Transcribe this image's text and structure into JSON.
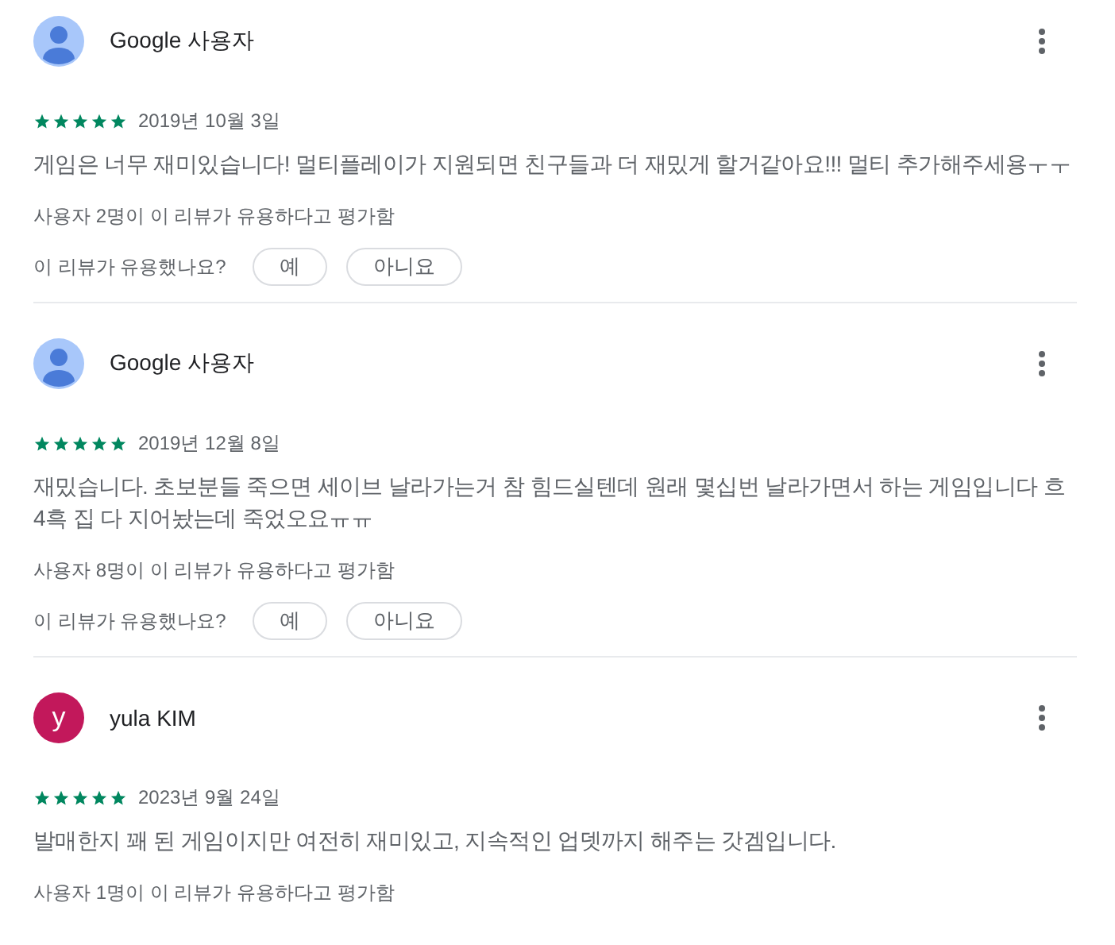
{
  "reviews": [
    {
      "author": "Google 사용자",
      "avatar": {
        "kind": "generic"
      },
      "stars": 5,
      "date": "2019년 10월 3일",
      "text": "게임은 너무 재미있습니다! 멀티플레이가 지원되면 친구들과 더 재밌게 할거같아요!!! 멀티 추가해주세용ㅜㅜ",
      "helpful_count": "사용자 2명이 이 리뷰가 유용하다고 평가함",
      "question": {
        "prompt": "이 리뷰가 유용했나요?",
        "yes": "예",
        "no": "아니요"
      }
    },
    {
      "author": "Google 사용자",
      "avatar": {
        "kind": "generic"
      },
      "stars": 5,
      "date": "2019년 12월 8일",
      "text": "재밌습니다. 초보분들 죽으면 세이브 날라가는거 참 힘드실텐데 원래 몇십번 날라가면서 하는 게임입니다 흐4흑 집 다 지어놨는데 죽었오요ㅠㅠ",
      "helpful_count": "사용자 8명이 이 리뷰가 유용하다고 평가함",
      "question": {
        "prompt": "이 리뷰가 유용했나요?",
        "yes": "예",
        "no": "아니요"
      }
    },
    {
      "author": "yula KIM",
      "avatar": {
        "kind": "letter",
        "letter": "y",
        "color": "#c2185b"
      },
      "stars": 5,
      "date": "2023년 9월 24일",
      "text": "발매한지 꽤 된 게임이지만 여전히 재미있고, 지속적인 업뎃까지 해주는 갓겜입니다.",
      "helpful_count": "사용자 1명이 이 리뷰가 유용하다고 평가함"
    }
  ]
}
